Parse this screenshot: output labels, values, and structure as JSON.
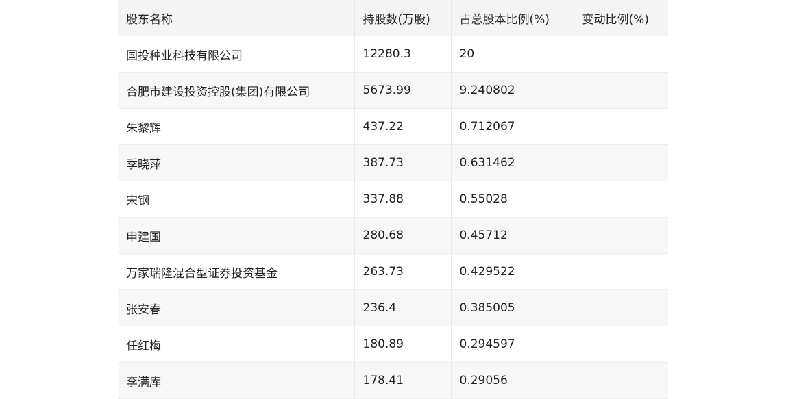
{
  "table": {
    "headers": [
      "股东名称",
      "持股数(万股)",
      "占总股本比例(%)",
      "变动比例(%)"
    ],
    "rows": [
      [
        "国投种业科技有限公司",
        "12280.3",
        "20",
        ""
      ],
      [
        "合肥市建设投资控股(集团)有限公司",
        "5673.99",
        "9.240802",
        ""
      ],
      [
        "朱黎辉",
        "437.22",
        "0.712067",
        ""
      ],
      [
        "季晓萍",
        "387.73",
        "0.631462",
        ""
      ],
      [
        "宋钢",
        "337.88",
        "0.55028",
        ""
      ],
      [
        "申建国",
        "280.68",
        "0.45712",
        ""
      ],
      [
        "万家瑞隆混合型证券投资基金",
        "263.73",
        "0.429522",
        ""
      ],
      [
        "张安春",
        "236.4",
        "0.385005",
        ""
      ],
      [
        "任红梅",
        "180.89",
        "0.294597",
        ""
      ],
      [
        "李满库",
        "178.41",
        "0.29056",
        ""
      ]
    ]
  }
}
